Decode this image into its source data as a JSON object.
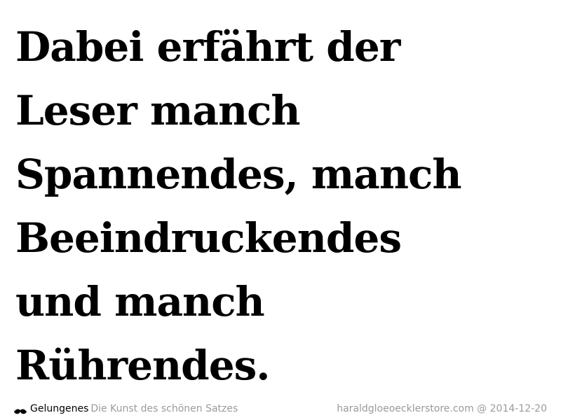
{
  "quote": {
    "lines": [
      "Dabei erfährt der",
      "Leser manch",
      "Spannendes, manch",
      "Beeindruckendes",
      "und manch",
      "Rührendes."
    ]
  },
  "footer": {
    "icon": "mustache-icon",
    "brand": "Gelungenes",
    "tagline": "Die Kunst des schönen Satzes",
    "source": "haraldgloeoecklerstore.com @ 2014-12-20",
    "colors": {
      "brand": "#000000",
      "muted": "#9a9a9a"
    }
  }
}
